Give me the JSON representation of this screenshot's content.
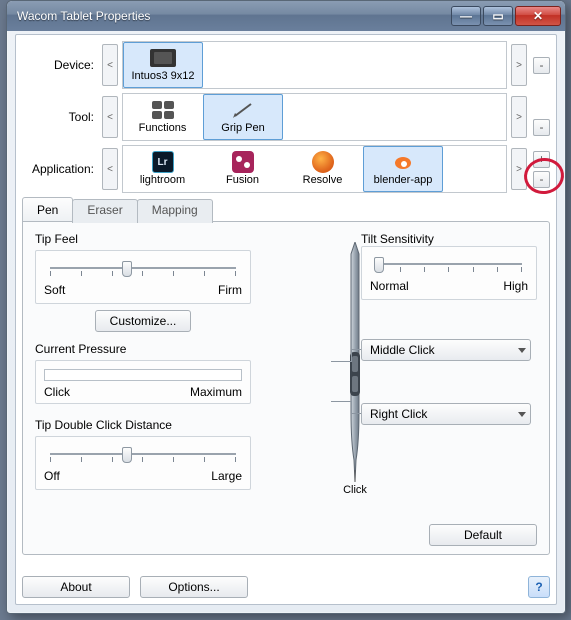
{
  "window_title": "Wacom Tablet Properties",
  "rows": {
    "device": {
      "label": "Device:",
      "items": [
        {
          "label": "Intuos3 9x12"
        }
      ],
      "selected": 0
    },
    "tool": {
      "label": "Tool:",
      "items": [
        {
          "label": "Functions"
        },
        {
          "label": "Grip Pen"
        }
      ],
      "selected": 1
    },
    "app": {
      "label": "Application:",
      "items": [
        {
          "label": "lightroom"
        },
        {
          "label": "Fusion"
        },
        {
          "label": "Resolve"
        },
        {
          "label": "blender-app"
        }
      ],
      "selected": 3
    }
  },
  "tabs": {
    "items": [
      "Pen",
      "Eraser",
      "Mapping"
    ],
    "active": 0
  },
  "pen_tab": {
    "tip_feel": {
      "label": "Tip Feel",
      "left": "Soft",
      "right": "Firm",
      "value": 0.42,
      "ticks": 7
    },
    "customize_btn": "Customize...",
    "current_pressure": {
      "label": "Current Pressure",
      "left": "Click",
      "right": "Maximum",
      "value": 0
    },
    "tip_double": {
      "label": "Tip Double Click Distance",
      "left": "Off",
      "right": "Large",
      "value": 0.42,
      "ticks": 7
    },
    "tilt_sens": {
      "label": "Tilt Sensitivity",
      "left": "Normal",
      "right": "High",
      "value": 0.05,
      "ticks": 7
    },
    "upper_button": "Middle Click",
    "lower_button": "Right Click",
    "tip_label": "Click",
    "default_btn": "Default"
  },
  "bottom": {
    "about": "About",
    "options": "Options...",
    "help": "?"
  },
  "glyphs": {
    "prev": "<",
    "next": ">",
    "plus": "+",
    "minus": "-",
    "min": "—",
    "max": "▭",
    "close": "✕",
    "caret": ""
  }
}
